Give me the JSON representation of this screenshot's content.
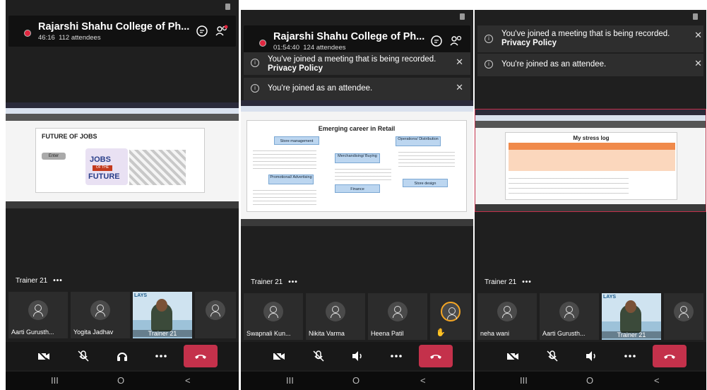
{
  "colors": {
    "end_call": "#c4314b",
    "recording": "#e0263f",
    "accent": "#f5a623"
  },
  "panels": [
    {
      "title": "Rajarshi Shahu College of Ph...",
      "timer": "46:16",
      "attendees": "112 attendees",
      "trainer_label": "Trainer 21",
      "more": "•••",
      "participants": [
        "Aarti Gurusth...",
        "Yogita  Jadhav"
      ],
      "video_name": "Trainer 21",
      "slide_text": {
        "heading": "FUTURE OF JOBS",
        "button": "Enter"
      },
      "icons": [
        "chat-icon",
        "participants-icon",
        "camera-off-icon",
        "mic-off-icon",
        "headphones-icon",
        "more-icon",
        "end-call-icon"
      ]
    },
    {
      "title": "Rajarshi Shahu College of Ph...",
      "timer": "01:54:40",
      "attendees": "124 attendees",
      "banner_recording": "You've joined a meeting that is being recorded.",
      "banner_policy": "Privacy Policy",
      "banner_attendee": "You're joined as an attendee.",
      "trainer_label": "Trainer 21",
      "more": "•••",
      "participants": [
        "Swapnali Kun...",
        "Nikita Varma",
        "Heena Patil"
      ],
      "slide_text": {
        "heading": "Emerging career in Retail",
        "b1": "Store management",
        "b2": "Merchandising/ Buying",
        "b3": "Operations/ Distribution",
        "b4": "Promotional/ Advertising",
        "b5": "Finance",
        "b6": "Store design"
      },
      "icons": [
        "camera-off-icon",
        "mic-off-icon",
        "speaker-icon",
        "more-icon",
        "end-call-icon"
      ]
    },
    {
      "banner_recording": "You've joined a meeting that is being recorded.",
      "banner_policy": "Privacy Policy",
      "banner_attendee": "You're joined as an attendee.",
      "trainer_label": "Trainer 21",
      "more": "•••",
      "participants": [
        "neha wani",
        "Aarti Gurusth..."
      ],
      "video_name": "Trainer 21",
      "slide_text": {
        "heading": "My stress log"
      },
      "icons": [
        "camera-off-icon",
        "mic-off-icon",
        "speaker-icon",
        "more-icon",
        "end-call-icon"
      ]
    }
  ],
  "nav": {
    "recents": "III",
    "home": "O",
    "back": "<"
  }
}
